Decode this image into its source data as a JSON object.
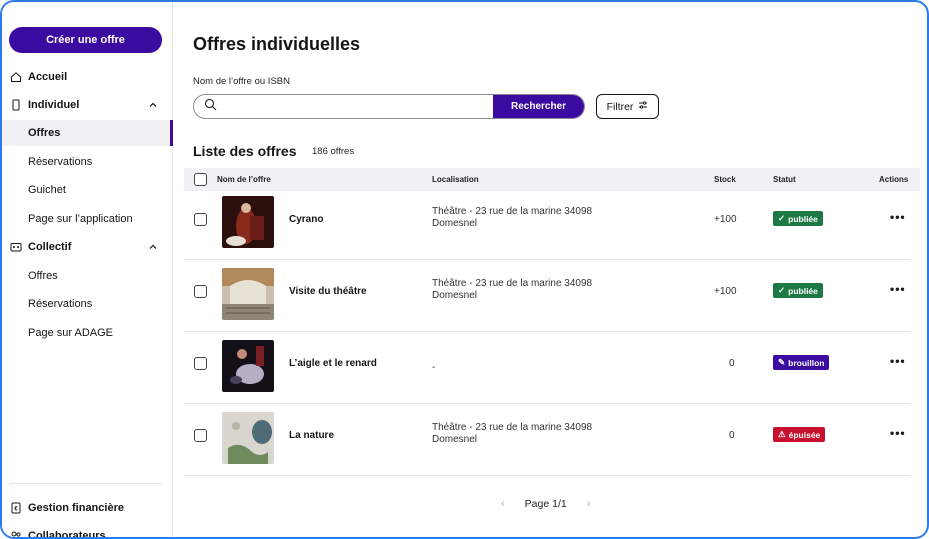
{
  "sidebar": {
    "create_button": "Créer une offre",
    "items": [
      {
        "label": "Accueil",
        "icon": "home-icon"
      },
      {
        "label": "Individuel",
        "icon": "phone-icon"
      },
      {
        "label": "Offres",
        "active": true
      },
      {
        "label": "Réservations"
      },
      {
        "label": "Guichet"
      },
      {
        "label": "Page sur l’application"
      },
      {
        "label": "Collectif",
        "icon": "collectif-icon"
      },
      {
        "label": "Offres"
      },
      {
        "label": "Réservations"
      },
      {
        "label": "Page sur ADAGE"
      }
    ],
    "footer": [
      {
        "label": "Gestion financière",
        "icon": "finance-icon"
      },
      {
        "label": "Collaborateurs",
        "icon": "users-icon"
      }
    ]
  },
  "main": {
    "title": "Offres individuelles",
    "search": {
      "label": "Nom de l’offre ou ISBN",
      "value": "",
      "placeholder": "",
      "button": "Rechercher"
    },
    "filter_button": "Filtrer",
    "list_title": "Liste des offres",
    "list_count": "186 offres",
    "columns": [
      "Nom de l’offre",
      "Localisation",
      "Stock",
      "Statut",
      "Actions"
    ],
    "rows": [
      {
        "name": "Cyrano",
        "location_line1": "Théâtre - 23 rue de la marine 34098",
        "location_line2": "Domesnel",
        "stock": "+100",
        "status": "publiée",
        "status_color": "#1e7a43"
      },
      {
        "name": "Visite du théâtre",
        "location_line1": "Théâtre - 23 rue de la marine 34098",
        "location_line2": "Domesnel",
        "stock": "+100",
        "status": "publiée",
        "status_color": "#1e7a43"
      },
      {
        "name": "L’aigle et le renard",
        "location_line1": "-",
        "location_line2": "",
        "stock": "0",
        "status": "brouillon",
        "status_color": "#3b0aa0"
      },
      {
        "name": "La nature",
        "location_line1": "Théâtre - 23 rue de la marine 34098",
        "location_line2": "Domesnel",
        "stock": "0",
        "status": "épuisée",
        "status_color": "#c8102e"
      }
    ],
    "actions_icon": "•••",
    "pagination": "Page 1/1"
  },
  "colors": {
    "primary": "#3b0aa0",
    "published": "#1e7a43",
    "draft": "#3b0aa0",
    "soldout": "#c8102e"
  }
}
